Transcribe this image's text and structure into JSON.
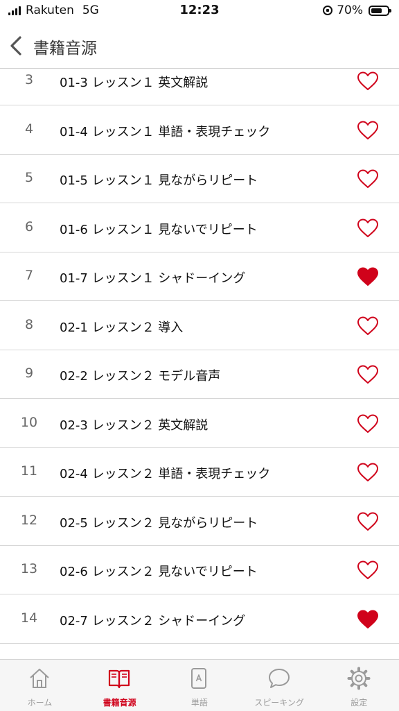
{
  "status_bar": {
    "carrier": "Rakuten",
    "network": "5G",
    "time": "12:23",
    "battery": "70%",
    "battery_level": 0.7
  },
  "header": {
    "title": "書籍音源",
    "back_icon": "chevron-left-icon"
  },
  "tracks": [
    {
      "num": "3",
      "title": "01-3 レッスン１ 英文解説",
      "favorite": false
    },
    {
      "num": "4",
      "title": "01-4 レッスン１ 単語・表現チェック",
      "favorite": false
    },
    {
      "num": "5",
      "title": "01-5 レッスン１ 見ながらリピート",
      "favorite": false
    },
    {
      "num": "6",
      "title": "01-6 レッスン１ 見ないでリピート",
      "favorite": false
    },
    {
      "num": "7",
      "title": "01-7 レッスン１ シャドーイング",
      "favorite": true
    },
    {
      "num": "8",
      "title": "02-1 レッスン２ 導入",
      "favorite": false
    },
    {
      "num": "9",
      "title": "02-2 レッスン２ モデル音声",
      "favorite": false
    },
    {
      "num": "10",
      "title": "02-3 レッスン２ 英文解説",
      "favorite": false
    },
    {
      "num": "11",
      "title": "02-4 レッスン２ 単語・表現チェック",
      "favorite": false
    },
    {
      "num": "12",
      "title": "02-5 レッスン２ 見ながらリピート",
      "favorite": false
    },
    {
      "num": "13",
      "title": "02-6 レッスン２ 見ないでリピート",
      "favorite": false
    },
    {
      "num": "14",
      "title": "02-7 レッスン２ シャドーイング",
      "favorite": true
    }
  ],
  "tab_bar": {
    "items": [
      {
        "label": "ホーム",
        "icon": "home-icon",
        "active": false
      },
      {
        "label": "書籍音源",
        "icon": "book-icon",
        "active": true
      },
      {
        "label": "単語",
        "icon": "vocabulary-card-icon",
        "active": false
      },
      {
        "label": "スピーキング",
        "icon": "speech-bubble-icon",
        "active": false
      },
      {
        "label": "設定",
        "icon": "gear-icon",
        "active": false
      }
    ]
  },
  "colors": {
    "accent": "#d0021b",
    "inactive": "#9a9a9a"
  }
}
